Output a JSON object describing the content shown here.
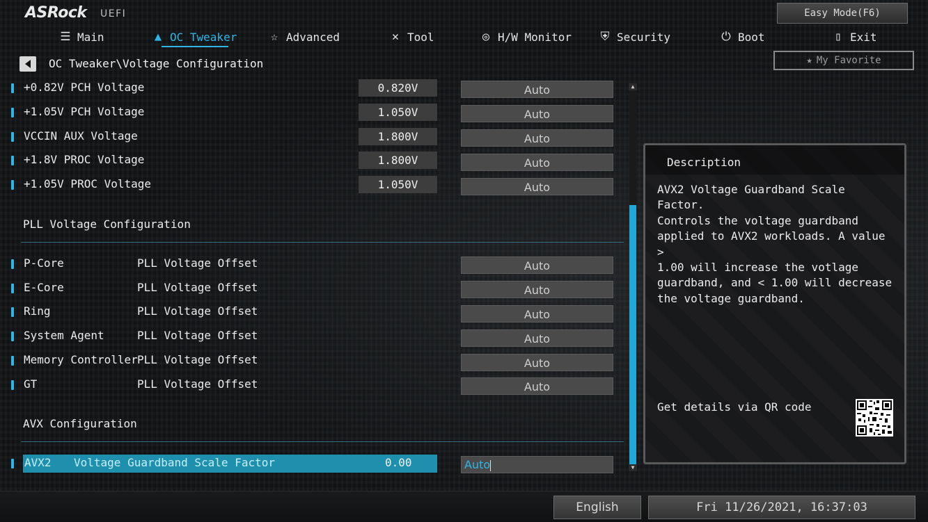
{
  "header": {
    "logo": "ASRock",
    "logo_sub": "UEFI",
    "easy_mode": "Easy Mode(F6)",
    "my_favorite": "My Favorite"
  },
  "nav": [
    {
      "label": "Main",
      "icon": "list-icon"
    },
    {
      "label": "OC Tweaker",
      "icon": "rocket-icon",
      "active": true
    },
    {
      "label": "Advanced",
      "icon": "star-icon"
    },
    {
      "label": "Tool",
      "icon": "tools-icon"
    },
    {
      "label": "H/W Monitor",
      "icon": "monitor-icon"
    },
    {
      "label": "Security",
      "icon": "shield-icon"
    },
    {
      "label": "Boot",
      "icon": "power-icon"
    },
    {
      "label": "Exit",
      "icon": "exit-icon"
    }
  ],
  "breadcrumb": "OC Tweaker\\Voltage Configuration",
  "voltage_rows": [
    {
      "label": "+0.82V PCH Voltage",
      "value": "0.820V",
      "option": "Auto"
    },
    {
      "label": "+1.05V PCH Voltage",
      "value": "1.050V",
      "option": "Auto"
    },
    {
      "label": "VCCIN AUX Voltage",
      "value": "1.800V",
      "option": "Auto"
    },
    {
      "label": "+1.8V PROC Voltage",
      "value": "1.800V",
      "option": "Auto"
    },
    {
      "label": "+1.05V PROC Voltage",
      "value": "1.050V",
      "option": "Auto"
    }
  ],
  "pll_section": "PLL Voltage Configuration",
  "pll_rows": [
    {
      "label": "P-Core",
      "sub": "PLL Voltage Offset",
      "option": "Auto"
    },
    {
      "label": "E-Core",
      "sub": "PLL Voltage Offset",
      "option": "Auto"
    },
    {
      "label": "Ring",
      "sub": "PLL Voltage Offset",
      "option": "Auto"
    },
    {
      "label": "System Agent",
      "sub": "PLL Voltage Offset",
      "option": "Auto"
    },
    {
      "label": "Memory Controller",
      "sub": "PLL Voltage Offset",
      "option": "Auto"
    },
    {
      "label": "GT",
      "sub": "PLL Voltage Offset",
      "option": "Auto"
    }
  ],
  "avx_section": "AVX Configuration",
  "selected_row": {
    "label_a": "AVX2",
    "label_b": "Voltage Guardband Scale Factor",
    "value": "0.00",
    "input": "Auto"
  },
  "description": {
    "title": "Description",
    "text": "AVX2 Voltage Guardband Scale Factor.\nControls the voltage guardband\napplied to AVX2 workloads. A value >\n1.00 will increase the votlage\nguardband, and < 1.00 will decrease\nthe voltage guardband.",
    "qr_label": "Get details via QR code"
  },
  "footer": {
    "language": "English",
    "datetime": "Fri 11/26/2021, 16:37:03"
  },
  "colors": {
    "accent": "#2fb6e6",
    "selected_bg": "#1e90ad"
  }
}
